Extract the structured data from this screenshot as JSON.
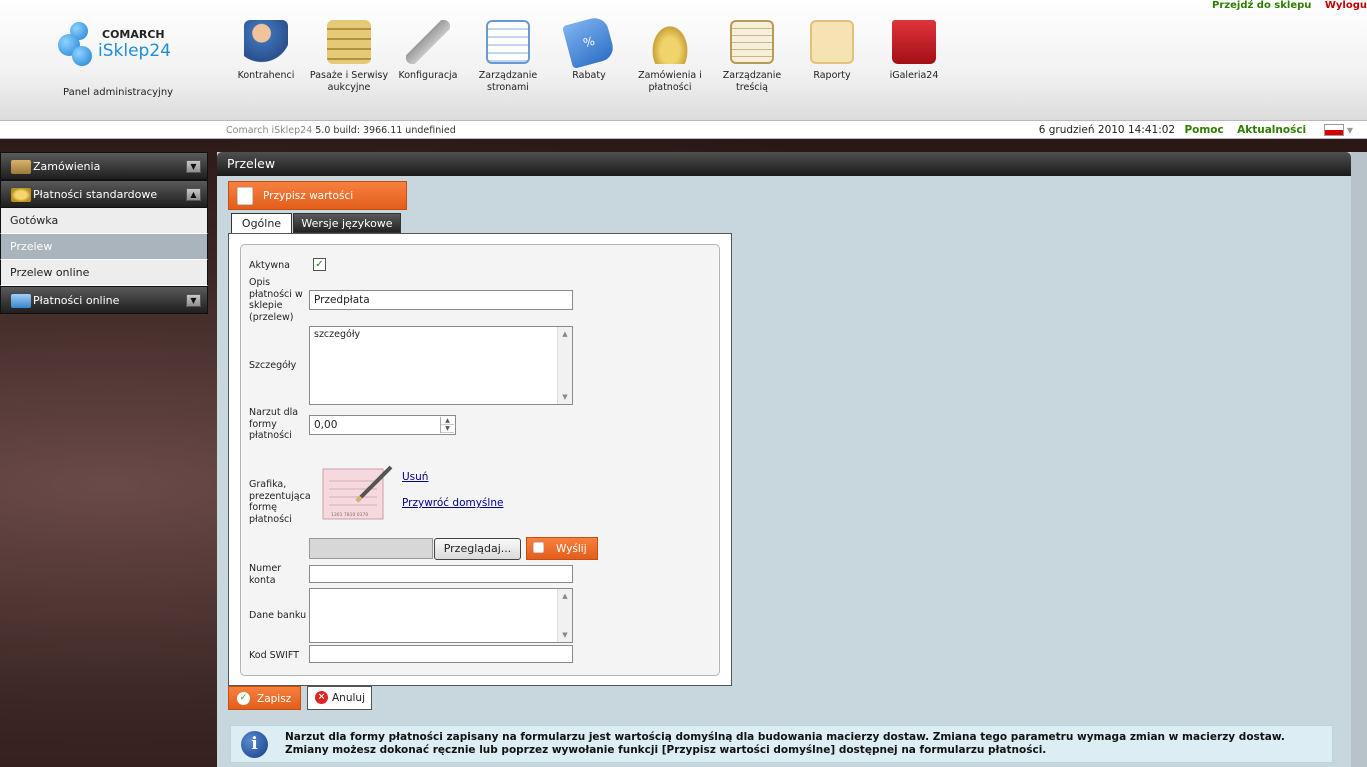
{
  "top_links": {
    "shop": "Przejdź do sklepu",
    "logout": "Wylogu"
  },
  "logo": {
    "brand": "COMARCH",
    "name": "iSklep24",
    "panel_label": "Panel administracyjny"
  },
  "nav": [
    {
      "label": "Kontrahenci",
      "icon": "contractors-icon",
      "color": "#3b6fb3"
    },
    {
      "label": "Pasaże i Serwisy aukcyjne",
      "icon": "auction-folder-icon",
      "color": "#d4b15a"
    },
    {
      "label": "Konfiguracja",
      "icon": "wrench-icon",
      "color": "#9a9a9a"
    },
    {
      "label": "Zarządzanie stronami",
      "icon": "page-edit-icon",
      "color": "#6a9ad6"
    },
    {
      "label": "Rabaty",
      "icon": "discount-tag-icon",
      "color": "#2b6ec6"
    },
    {
      "label": "Zamówienia i płatności",
      "icon": "coins-icon",
      "color": "#c9a23a"
    },
    {
      "label": "Zarządzanie treścią",
      "icon": "content-edit-icon",
      "color": "#b89b58"
    },
    {
      "label": "Raporty",
      "icon": "clipboard-icon",
      "color": "#e2c27a"
    },
    {
      "label": "iGaleria24",
      "icon": "shopping-bag-icon",
      "color": "#c91a22"
    }
  ],
  "build": {
    "product": "Comarch iSklep24",
    "version": "5.0 build: 3966.11  undefinied"
  },
  "status": {
    "datetime": "6 grudzień 2010 14:41:02",
    "help": "Pomoc",
    "news": "Aktualności"
  },
  "sidebar": {
    "sections": [
      {
        "label": "Zamówienia"
      },
      {
        "label": "Płatności standardowe"
      },
      {
        "label": "Płatności online"
      }
    ],
    "items": [
      {
        "label": "Gotówka"
      },
      {
        "label": "Przelew"
      },
      {
        "label": "Przelew online"
      }
    ]
  },
  "main": {
    "title": "Przelew",
    "defaults_button": "Przypisz wartości domyślne",
    "tabs": [
      {
        "label": "Ogólne"
      },
      {
        "label": "Wersje językowe"
      }
    ]
  },
  "form": {
    "active_label": "Aktywna",
    "active_checked": true,
    "description_label": [
      "Opis",
      "płatności w",
      "sklepie",
      "(przelew)"
    ],
    "description_value": "Przedpłata",
    "details_label": "Szczegóły",
    "details_value": "szczegóły",
    "surcharge_label": [
      "Narzut dla",
      "formy",
      "płatności"
    ],
    "surcharge_value": "0,00",
    "graphic_label": [
      "Grafika,",
      "prezentująca",
      "formę",
      "płatności"
    ],
    "graphic_card_text": "1301 7810 0370",
    "remove_link": "Usuń",
    "restore_link": "Przywróć domyślne",
    "browse_button": "Przeglądaj...",
    "send_button": "Wyślij",
    "account_label": [
      "Numer",
      "konta"
    ],
    "account_value": "",
    "bank_label": "Dane banku",
    "bank_value": "",
    "swift_label": "Kod SWIFT",
    "swift_value": ""
  },
  "actions": {
    "save": "Zapisz",
    "cancel": "Anuluj"
  },
  "info": {
    "line1": "Narzut dla formy płatności zapisany na formularzu jest wartością domyślną dla budowania macierzy dostaw. Zmiana tego parametru wymaga zmian w macierzy dostaw.",
    "line2": "Zmiany możesz dokonać ręcznie lub poprzez wywołanie funkcji [Przypisz wartości domyślne] dostępnej na formularzu płatności."
  },
  "colors": {
    "accent_orange": "#ef6b2a",
    "header_dark": "#2a2a2a",
    "link_green": "#2e7d00",
    "logout_red": "#c00000",
    "logo_blue": "#1d8ed8"
  }
}
